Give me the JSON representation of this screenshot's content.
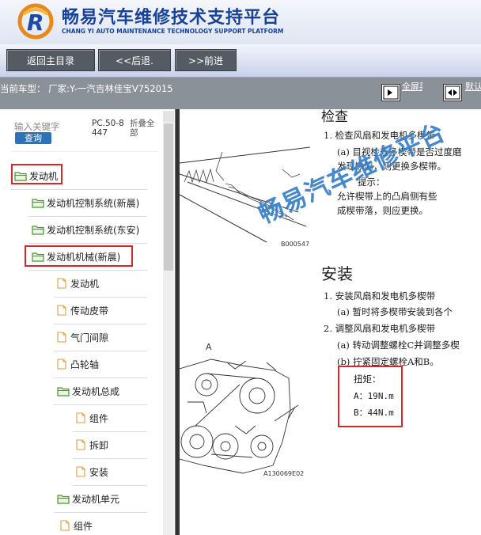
{
  "header": {
    "title_cn": "畅易汽车维修技术支持平台",
    "title_en": "CHANG YI AUTO MAINTENANCE TECHNOLOGY SUPPORT PLATFORM",
    "logo_icon": "chang-yi-logo"
  },
  "nav": {
    "home_label": "返回主目录",
    "back_label": "<<后退.",
    "forward_label": ">>前进"
  },
  "info": {
    "car_model": "当前车型：  厂家:Y-一汽吉林佳宝V752015",
    "fullscreen_label": "全屏菜单",
    "default_label": "默认视图"
  },
  "sidebar": {
    "keyword_placeholder": "输入关键字",
    "search_label": "查询",
    "pc_code": "PC.50-8447",
    "collapse_all": "折叠全部",
    "items": [
      {
        "label": "发动机",
        "type": "folder",
        "highlighted": true
      },
      {
        "label": "发动机控制系统(新晨)",
        "type": "folder"
      },
      {
        "label": "发动机控制系统(东安)",
        "type": "folder"
      },
      {
        "label": "发动机机械(新晨)",
        "type": "folder",
        "highlighted": true
      },
      {
        "label": "发动机",
        "type": "doc"
      },
      {
        "label": "传动皮带",
        "type": "doc"
      },
      {
        "label": "气门间隙",
        "type": "doc"
      },
      {
        "label": "凸轮轴",
        "type": "doc"
      },
      {
        "label": "发动机总成",
        "type": "folder"
      },
      {
        "label": "组件",
        "type": "doc"
      },
      {
        "label": "拆卸",
        "type": "doc"
      },
      {
        "label": "安装",
        "type": "doc"
      },
      {
        "label": "发动机单元",
        "type": "folder"
      },
      {
        "label": "组件",
        "type": "doc"
      }
    ]
  },
  "document": {
    "heading_check": "检查",
    "step1_title": "1.   检查风扇和发电机多楔带",
    "step1_a_line1": "(a)  目视检查多楔带是否过度磨",
    "step1_a_line2": "      发现缺陷，则更换多楔带。",
    "hint_label": "提示：",
    "hint_line1": "      允许楔带上的凸肩侧有些",
    "hint_line2": "      成楔带落，则应更换。",
    "image1_code": "B000547",
    "heading_install": "安装",
    "inst1_title": "1.   安装风扇和发电机多楔带",
    "inst1_a": "(a)  暂时将多楔带安装到各个",
    "inst2_title": "2.   调整风扇和发电机多楔带",
    "inst2_a": "(a)  转动调整螺栓C并调整多楔",
    "inst2_b": "(b)  拧紧固定螺栓A和B。",
    "torque_label": "扭矩：",
    "torque_a": "A：19N.m",
    "torque_b": "B：44N.m",
    "image2_label": "A",
    "image2_code": "A130069E02",
    "watermark": "畅易汽车维修平台"
  },
  "colors": {
    "brand_blue": "#17429b",
    "nav_button": "#555b63",
    "info_bar": "#8b9199",
    "highlight_red": "#d9262b",
    "search_button": "#2b73b8"
  }
}
